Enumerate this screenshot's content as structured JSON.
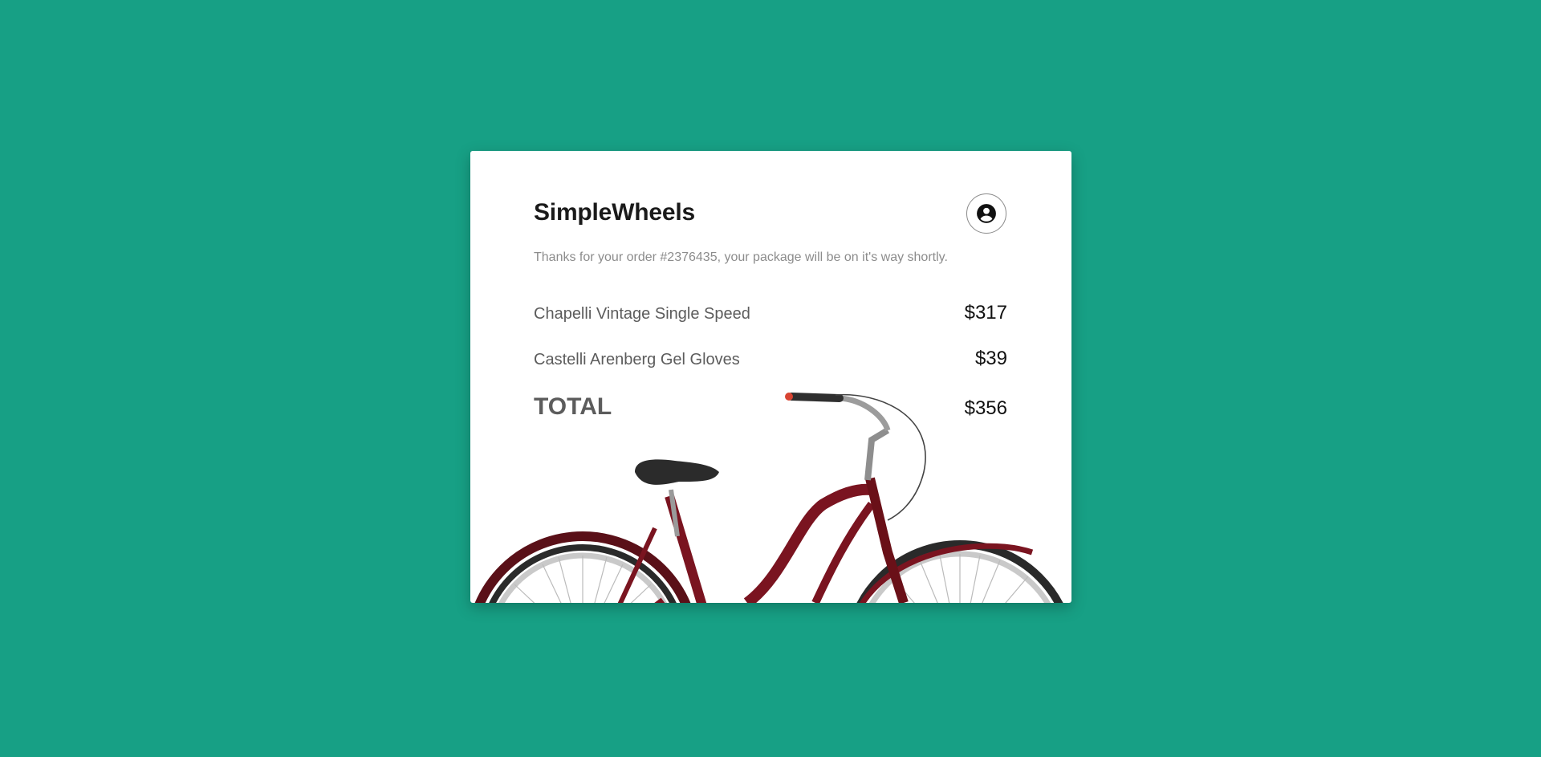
{
  "brand": "SimpleWheels",
  "account_icon": "account-circle-icon",
  "message": "Thanks for your order #2376435, your package will be on it's way shortly.",
  "items": [
    {
      "name": "Chapelli Vintage Single Speed",
      "price": "$317"
    },
    {
      "name": "Castelli Arenberg Gel Gloves",
      "price": "$39"
    }
  ],
  "total": {
    "label": "TOTAL",
    "price": "$356"
  },
  "colors": {
    "background": "#17a085",
    "card": "#ffffff",
    "bike_frame": "#7a1420"
  }
}
